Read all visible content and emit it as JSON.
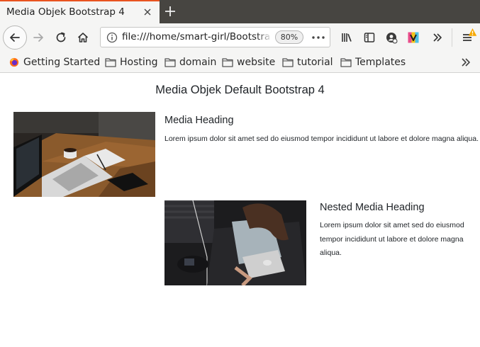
{
  "browser": {
    "tab": {
      "title": "Media Objek Bootstrap 4"
    },
    "url": "file:///home/smart-girl/Bootstrap",
    "zoom": "80%",
    "bookmarks": [
      "Getting Started",
      "Hosting",
      "domain",
      "website",
      "tutorial",
      "Templates"
    ]
  },
  "page": {
    "title": "Media Objek Default Bootstrap 4",
    "media": {
      "heading": "Media Heading",
      "text": "Lorem ipsum dolor sit amet sed do eiusmod tempor incididunt ut labore et dolore magna aliqua."
    },
    "nested_media": {
      "heading": "Nested Media Heading",
      "text": "Lorem ipsum dolor sit amet sed do eiusmod tempor incididunt ut labore et dolore magna aliqua."
    }
  },
  "icons": {
    "back": "back-arrow-icon",
    "forward": "forward-arrow-icon",
    "reload": "reload-icon",
    "home": "home-icon",
    "info": "info-icon",
    "page_actions": "more-dots-icon",
    "library": "library-icon",
    "sidebar": "sidebar-icon",
    "extension1": "account-icon",
    "extension2": "vivaldi-icon",
    "overflow": "chevron-double-right-icon",
    "menu": "hamburger-menu-icon",
    "alert": "warning-badge-icon"
  },
  "colors": {
    "tab_accent": "#e95420",
    "tabstrip_bg": "#474541",
    "toolbar_bg": "#f5f5f4",
    "text": "#212529"
  }
}
